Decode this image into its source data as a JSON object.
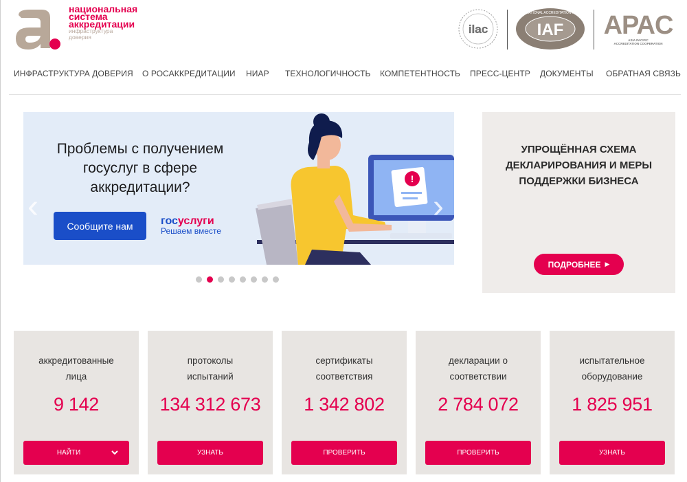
{
  "logo": {
    "line1": "национальная",
    "line2": "система",
    "line3": "аккредитации",
    "line4": "инфраструктура",
    "line5": "доверия"
  },
  "partners": {
    "ilac": "ilac",
    "iaf": "IAF",
    "iaf_ring": "INTERNATIONAL ACCREDITATION FORUM",
    "apac": "APAC",
    "apac_sub1": "ASIA PACIFIC",
    "apac_sub2": "ACCREDITATION COOPERATION"
  },
  "nav": [
    {
      "label": "ИНФРАСТРУКТУРА ДОВЕРИЯ"
    },
    {
      "label": "О РОСАККРЕДИТАЦИИ"
    },
    {
      "label": "НИАР"
    },
    {
      "label": "ТЕХНОЛОГИЧНОСТЬ"
    },
    {
      "label": "КОМПЕТЕНТНОСТЬ"
    },
    {
      "label": "ПРЕСС-ЦЕНТР"
    },
    {
      "label": "ДОКУМЕНТЫ"
    },
    {
      "label": "ОБРАТНАЯ СВЯЗЬ"
    }
  ],
  "hero": {
    "title": "Проблемы с получением госуслуг в сфере аккредитации?",
    "button": "Сообщите нам",
    "brand_part1": "гос",
    "brand_part2": "услуги",
    "brand_sub": "Решаем вместе",
    "alert_glyph": "!",
    "prev_arrow": "‹",
    "next_arrow": "›"
  },
  "carousel": {
    "slides": 8,
    "active": 1
  },
  "promo": {
    "title": "УПРОЩЁННАЯ СХЕМА ДЕКЛАРИРОВАНИЯ И МЕРЫ ПОДДЕРЖКИ БИЗНЕСА",
    "button": "ПОДРОБНЕЕ",
    "button_glyph": "▶"
  },
  "stats": [
    {
      "line1": "аккредитованные",
      "line2": "лица",
      "value": "9 142",
      "button": "НАЙТИ",
      "has_chevron": true
    },
    {
      "line1": "протоколы",
      "line2": "испытаний",
      "value": "134 312 673",
      "button": "УЗНАТЬ"
    },
    {
      "line1": "сертификаты",
      "line2": "соответствия",
      "value": "1 342 802",
      "button": "ПРОВЕРИТЬ"
    },
    {
      "line1": "декларации о",
      "line2": "соответствии",
      "value": "2 784 072",
      "button": "ПРОВЕРИТЬ"
    },
    {
      "line1": "испытательное",
      "line2": "оборудование",
      "value": "1 825 951",
      "button": "УЗНАТЬ"
    }
  ],
  "colors": {
    "accent": "#e4004f",
    "gos_blue": "#1a4ec8",
    "card_bg": "#e8e5e2",
    "promo_bg": "#efecea",
    "hero_bg": "#e3ecf8"
  }
}
